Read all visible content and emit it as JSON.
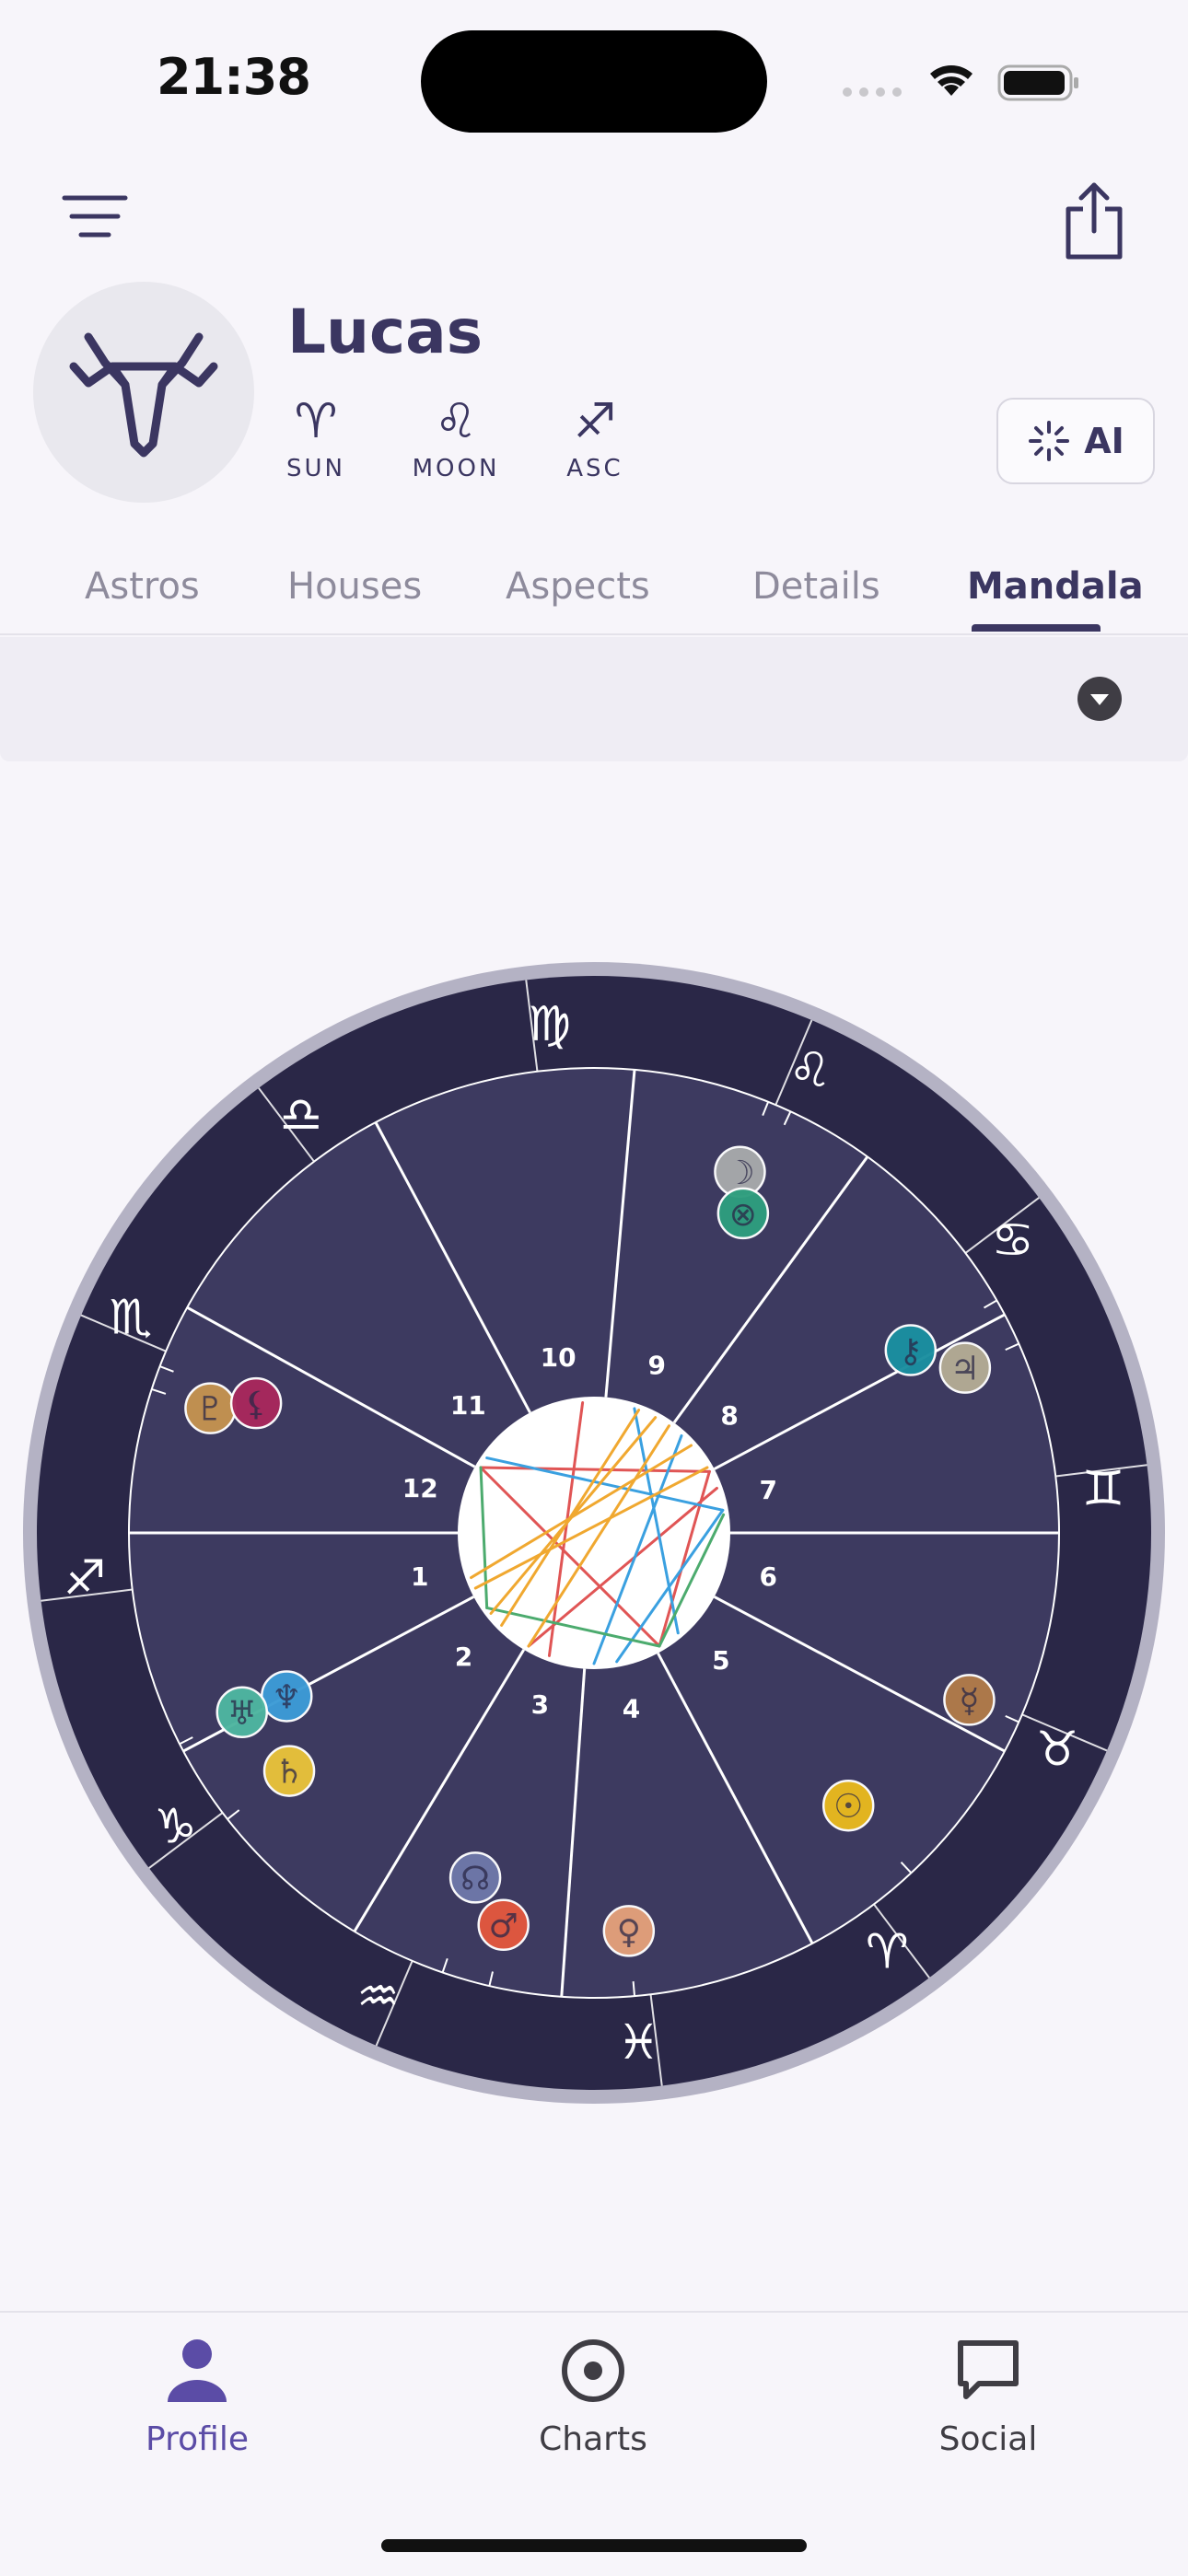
{
  "status_bar": {
    "time": "21:38"
  },
  "header": {
    "menu_icon": "hamburger-menu-icon",
    "share_icon": "share-icon",
    "avatar_icon": "taurus-head-icon"
  },
  "profile": {
    "name": "Lucas",
    "big_three": [
      {
        "glyph": "♈",
        "label": "SUN"
      },
      {
        "glyph": "♌",
        "label": "MOON"
      },
      {
        "glyph": "♐",
        "label": "ASC"
      }
    ],
    "ai_button": {
      "label": "AI",
      "icon": "sparkle-icon"
    }
  },
  "tabs": [
    {
      "label": "Astros"
    },
    {
      "label": "Houses"
    },
    {
      "label": "Aspects"
    },
    {
      "label": "Details"
    },
    {
      "label": "Mandala",
      "active": true
    }
  ],
  "filter": {
    "dropdown_icon": "caret-down-icon"
  },
  "mandala": {
    "signs": [
      "♈",
      "♉",
      "♊",
      "♋",
      "♌",
      "♍",
      "♎",
      "♏",
      "♐",
      "♑",
      "♒",
      "♓"
    ],
    "houses": [
      "1",
      "2",
      "3",
      "4",
      "5",
      "6",
      "7",
      "8",
      "9",
      "10",
      "11",
      "12"
    ],
    "planets": [
      {
        "name": "moon",
        "glyph": "☽",
        "color": "#a7a9ab"
      },
      {
        "name": "part-of-fortune",
        "glyph": "⊗",
        "color": "#2e9e7e"
      },
      {
        "name": "chiron",
        "glyph": "⚷",
        "color": "#1a8fa0"
      },
      {
        "name": "jupiter",
        "glyph": "♃",
        "color": "#b3ab94"
      },
      {
        "name": "mercury",
        "glyph": "☿",
        "color": "#b07a4a"
      },
      {
        "name": "sun",
        "glyph": "☉",
        "color": "#e8b81e"
      },
      {
        "name": "venus",
        "glyph": "♀",
        "color": "#e3a07a"
      },
      {
        "name": "mars",
        "glyph": "♂",
        "color": "#e2573e"
      },
      {
        "name": "north-node",
        "glyph": "☊",
        "color": "#6e77a9"
      },
      {
        "name": "saturn",
        "glyph": "♄",
        "color": "#e8c23a"
      },
      {
        "name": "neptune",
        "glyph": "♆",
        "color": "#3c9bd6"
      },
      {
        "name": "uranus",
        "glyph": "♅",
        "color": "#4eb5a0"
      },
      {
        "name": "pluto",
        "glyph": "♇",
        "color": "#c49250"
      },
      {
        "name": "lilith",
        "glyph": "⚸",
        "color": "#a8285c"
      }
    ],
    "colors": {
      "ring": "#2a2747",
      "house_fill": "#3d3a60",
      "outer_rim": "#b4b2c4",
      "aspect_red": "#e05555",
      "aspect_blue": "#3aa0e0",
      "aspect_green": "#4cab6e",
      "aspect_orange": "#f0a830"
    }
  },
  "bottom_nav": [
    {
      "label": "Profile",
      "icon": "person-icon",
      "active": true
    },
    {
      "label": "Charts",
      "icon": "target-icon"
    },
    {
      "label": "Social",
      "icon": "chat-bubble-icon"
    }
  ]
}
